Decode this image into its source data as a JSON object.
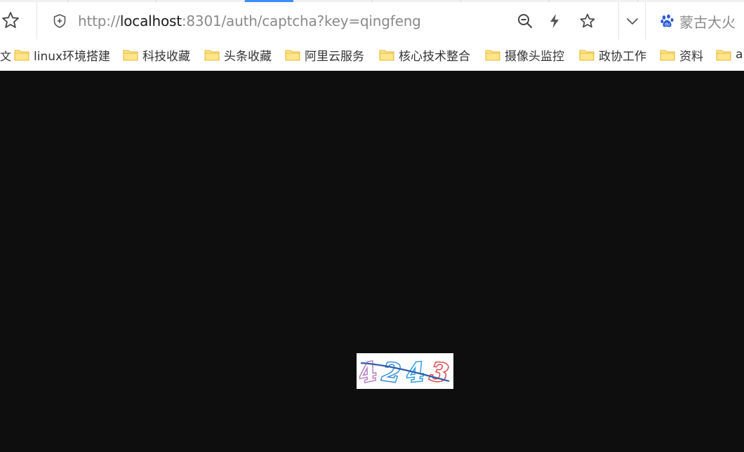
{
  "browser": {
    "address_bar": {
      "url_scheme": "http://",
      "url_host": "localhost",
      "url_rest": ":8301/auth/captcha?key=qingfeng"
    },
    "search_engine": {
      "label": "蒙古大火"
    },
    "icons": {
      "bookmark_star": "star-outline-icon",
      "security": "shield-icon",
      "zoom": "magnifier-minus-icon",
      "lightning": "lightning-icon",
      "favorite": "star-icon",
      "dropdown": "chevron-down-icon",
      "baidu": "paw-icon"
    },
    "accent_color": "#3e8ef7"
  },
  "bookmarks": {
    "edge_fragment": "文",
    "items": [
      {
        "label": "linux环境搭建"
      },
      {
        "label": "科技收藏"
      },
      {
        "label": "头条收藏"
      },
      {
        "label": "阿里云服务"
      },
      {
        "label": "核心技术整合"
      },
      {
        "label": "摄像头监控"
      },
      {
        "label": "政协工作"
      },
      {
        "label": "资料"
      },
      {
        "label": "a"
      }
    ]
  },
  "page": {
    "background": "#0e0e0e",
    "captcha": {
      "code": "4243",
      "digit_colors": [
        "#b77fc2",
        "#3a8fd8",
        "#2f9de0",
        "#d94848"
      ]
    }
  }
}
